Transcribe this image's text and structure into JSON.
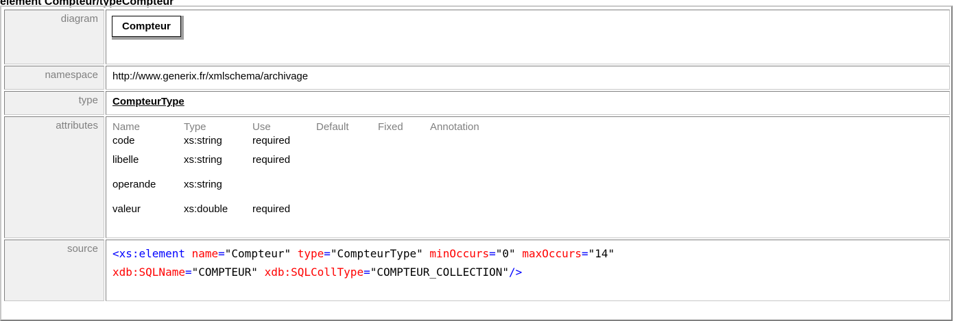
{
  "page": {
    "title": "element Compteur/typeCompteur"
  },
  "rows": {
    "diagram": {
      "label": "diagram",
      "node": "Compteur"
    },
    "namespace": {
      "label": "namespace",
      "value": "http://www.generix.fr/xmlschema/archivage"
    },
    "type": {
      "label": "type",
      "value": "CompteurType"
    },
    "attributes": {
      "label": "attributes",
      "headers": [
        "Name",
        "Type",
        "Use",
        "Default",
        "Fixed",
        "Annotation"
      ],
      "rows": [
        {
          "name": "code",
          "type": "xs:string",
          "use": "required"
        },
        {
          "name": "libelle",
          "type": "xs:string",
          "use": "required"
        },
        {
          "name": "operande",
          "type": "xs:string",
          "use": ""
        },
        {
          "name": "valeur",
          "type": "xs:double",
          "use": "required"
        }
      ]
    },
    "source": {
      "label": "source",
      "tag_open": "<xs:element",
      "a1n": "name",
      "a1v": "\"Compteur\"",
      "a2n": "type",
      "a2v": "\"CompteurType\"",
      "a3n": "minOccurs",
      "a3v": "\"0\"",
      "a4n": "maxOccurs",
      "a4v": "\"14\"",
      "a5n": "xdb:SQLName",
      "a5v": "\"COMPTEUR\"",
      "a6n": "xdb:SQLCollType",
      "a6v": "\"COMPTEUR_COLLECTION\"",
      "tag_close": "/>"
    }
  }
}
